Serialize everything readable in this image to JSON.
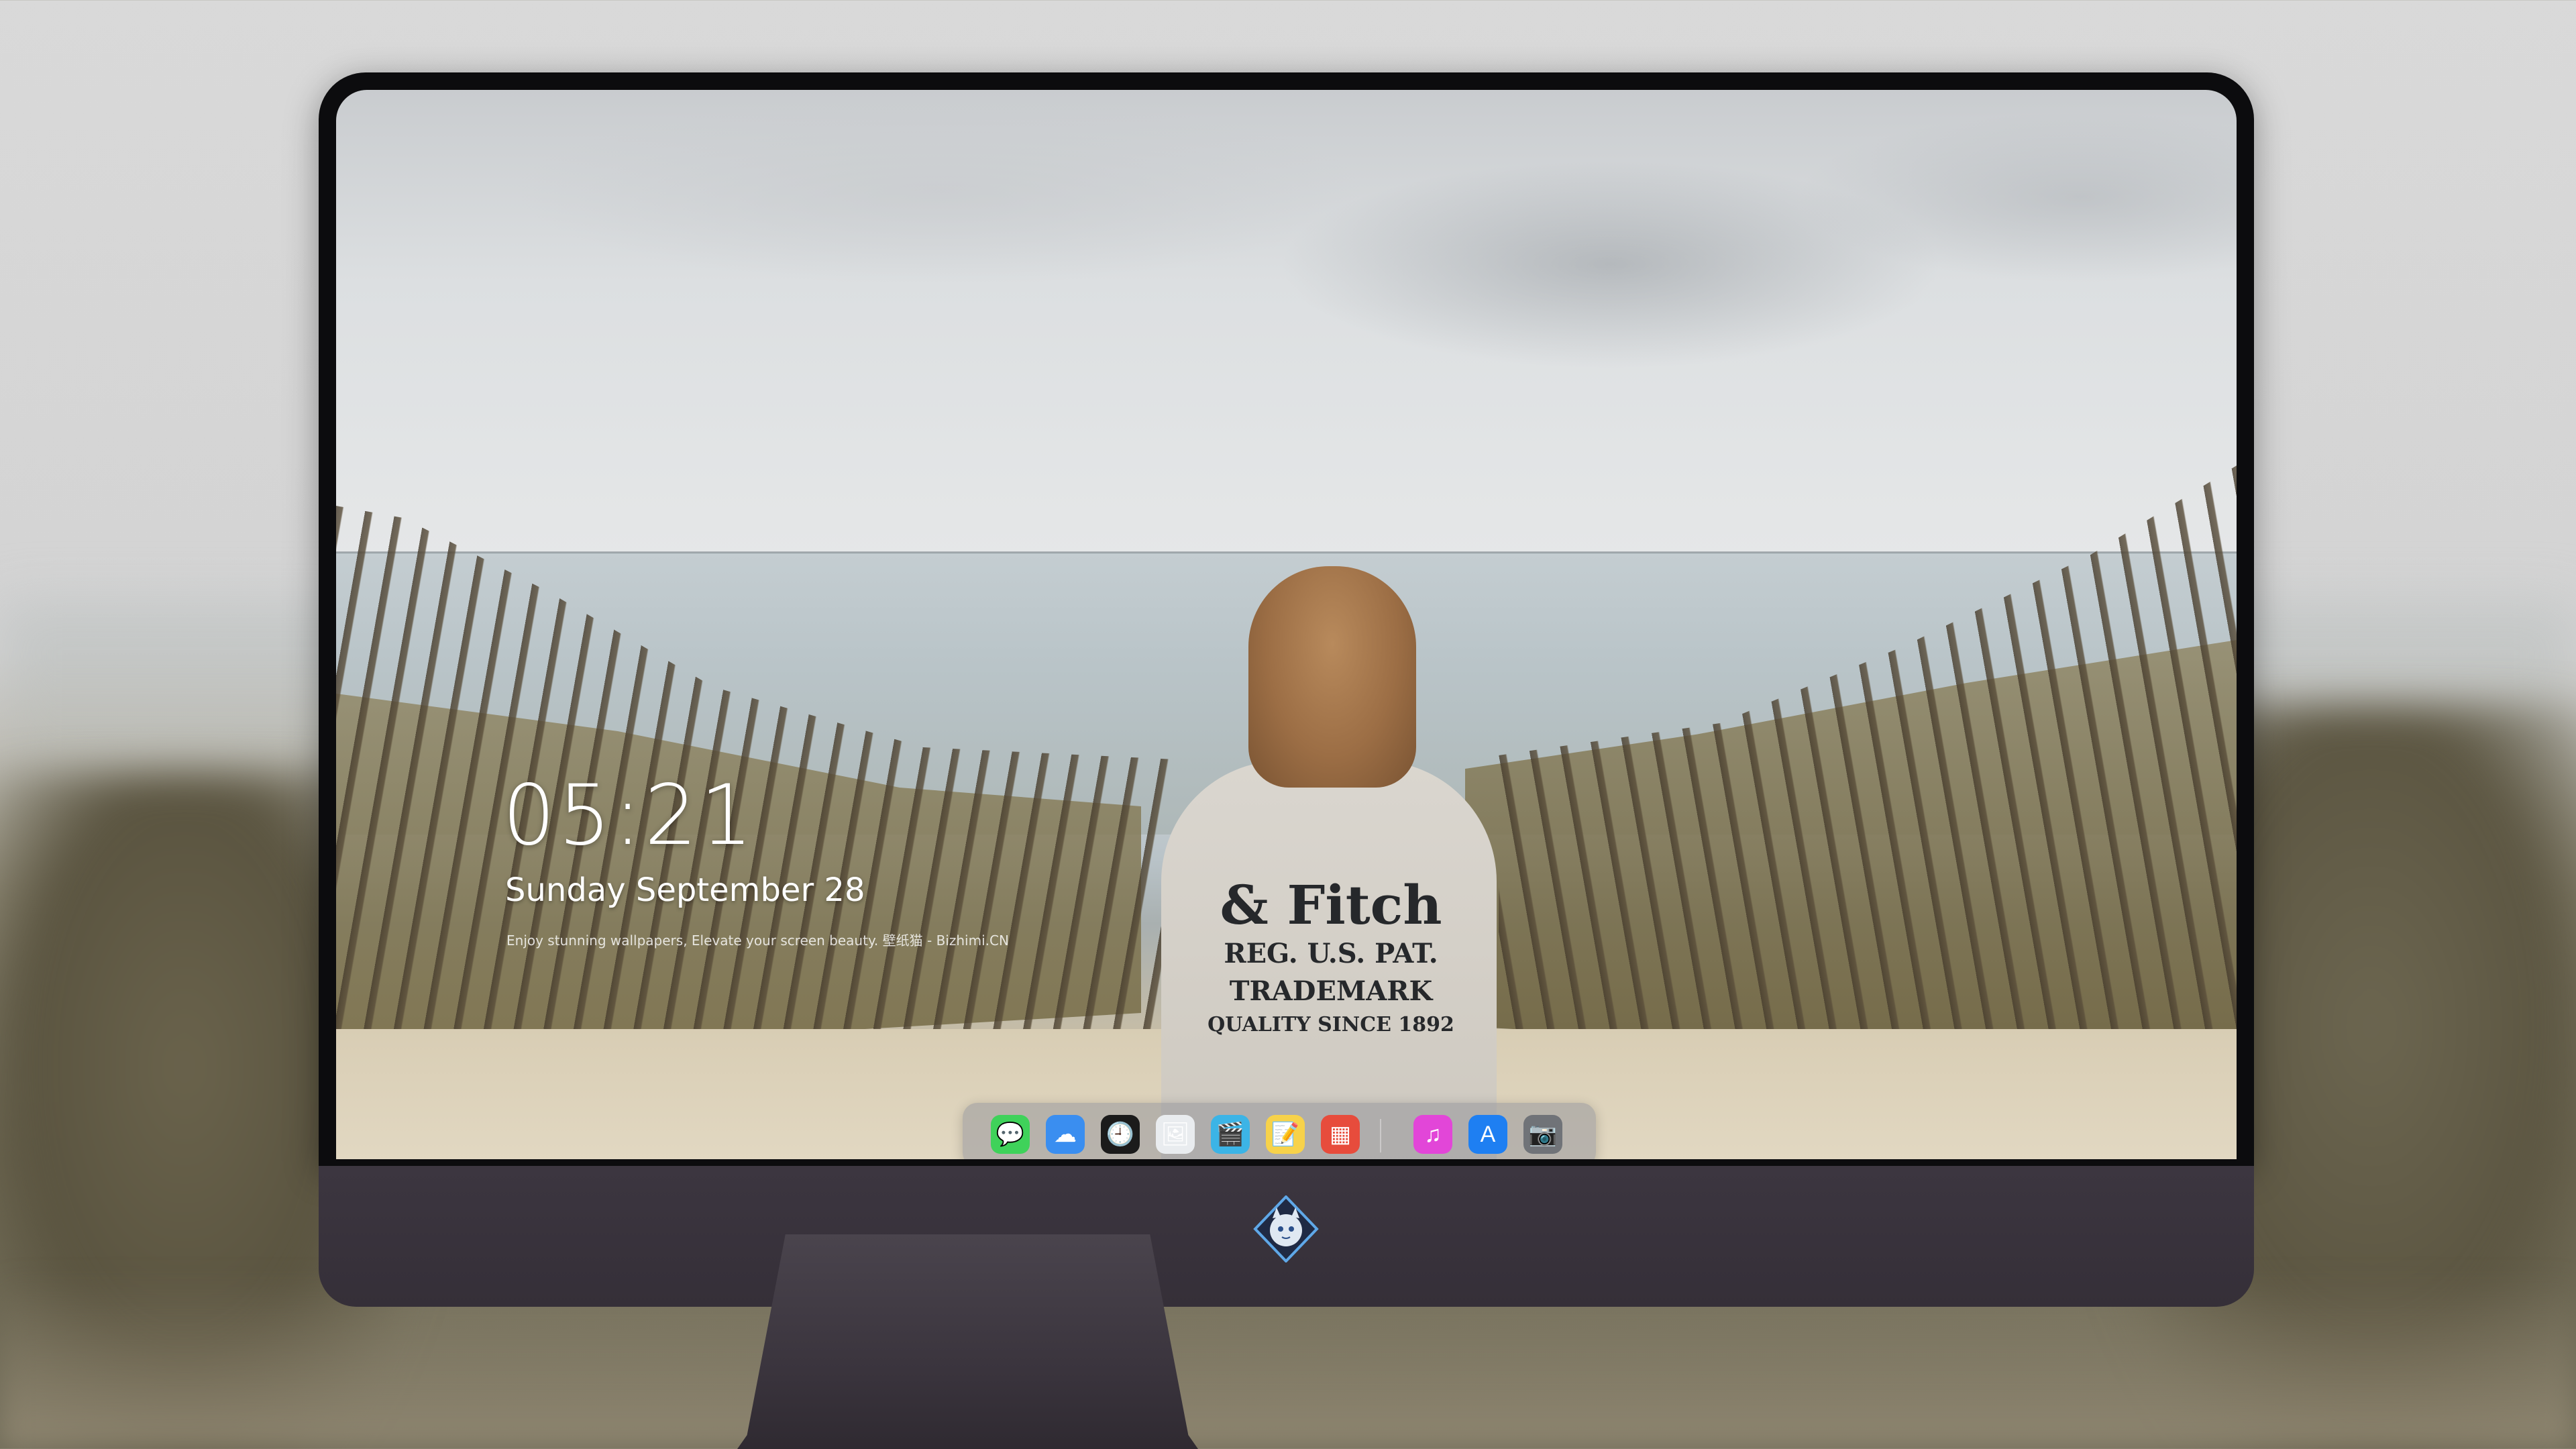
{
  "lock_screen": {
    "time": "05:21",
    "date": "Sunday September  28",
    "tagline": "Enjoy stunning wallpapers, Elevate your screen beauty. 壁纸猫 - Bizhimi.CN"
  },
  "wallpaper": {
    "print_line1": "& Fitch",
    "print_line2": "REG. U.S. PAT. TRADEMARK",
    "print_line3": "QUALITY SINCE 1892"
  },
  "dock": {
    "apps": [
      {
        "name": "messages-icon",
        "glyph": "💬",
        "color": "#3fd25a"
      },
      {
        "name": "weather-icon",
        "glyph": "☁",
        "color": "#3a8ef0"
      },
      {
        "name": "clock-icon",
        "glyph": "🕘",
        "color": "#1b1b1b"
      },
      {
        "name": "preview-icon",
        "glyph": "🖼",
        "color": "#e9ecef"
      },
      {
        "name": "clips-icon",
        "glyph": "🎬",
        "color": "#3cb4e6"
      },
      {
        "name": "notes-icon",
        "glyph": "📝",
        "color": "#f7d24a"
      },
      {
        "name": "photo-booth-icon",
        "glyph": "▦",
        "color": "#e74c3c"
      },
      {
        "name": "music-icon",
        "glyph": "♫",
        "color": "#e246d8"
      },
      {
        "name": "app-store-icon",
        "glyph": "A",
        "color": "#1e7ff2"
      },
      {
        "name": "camera-icon",
        "glyph": "📷",
        "color": "#707378"
      }
    ]
  }
}
